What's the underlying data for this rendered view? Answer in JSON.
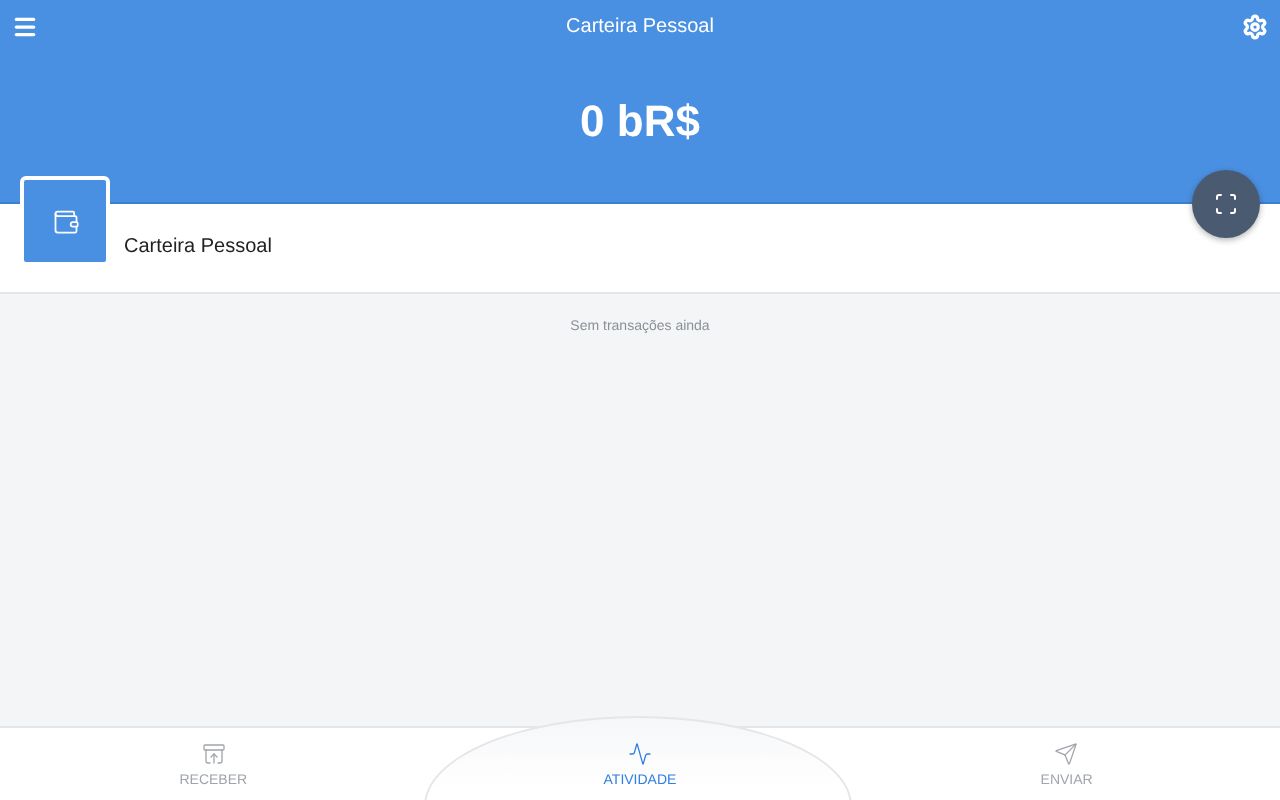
{
  "header": {
    "title": "Carteira Pessoal",
    "balance": "0 bR$"
  },
  "wallet": {
    "name": "Carteira Pessoal"
  },
  "activity": {
    "empty_message": "Sem transações ainda"
  },
  "nav": [
    {
      "label": "RECEBER",
      "kind": "receive",
      "selected": false
    },
    {
      "label": "ATIVIDADE",
      "kind": "activity",
      "selected": true
    },
    {
      "label": "ENVIAR",
      "kind": "send",
      "selected": false
    }
  ]
}
